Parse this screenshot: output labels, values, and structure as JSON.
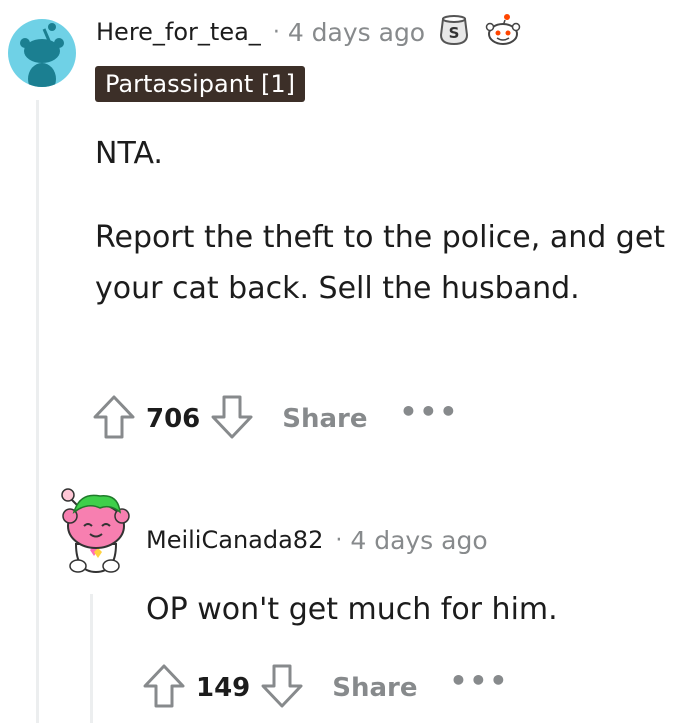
{
  "comment": {
    "username": "Here_for_tea_",
    "separator": "·",
    "time": "4 days ago",
    "flair": "Partassipant [1]",
    "paragraphs": [
      "NTA.",
      "Report the theft to the police, and get your cat back. Sell the husband."
    ],
    "votes": "706",
    "share_label": "Share",
    "more_label": "•••",
    "avatar_color": "#6fd1e6"
  },
  "reply": {
    "username": "MeiliCanada82",
    "separator": "·",
    "time": "4 days ago",
    "text": "OP won't get much for him.",
    "votes": "149",
    "share_label": "Share",
    "more_label": "•••"
  },
  "colors": {
    "text": "#1c1c1c",
    "meta": "#878a8c",
    "flair_bg": "#3c2f28",
    "thread_line": "#eceeef"
  }
}
